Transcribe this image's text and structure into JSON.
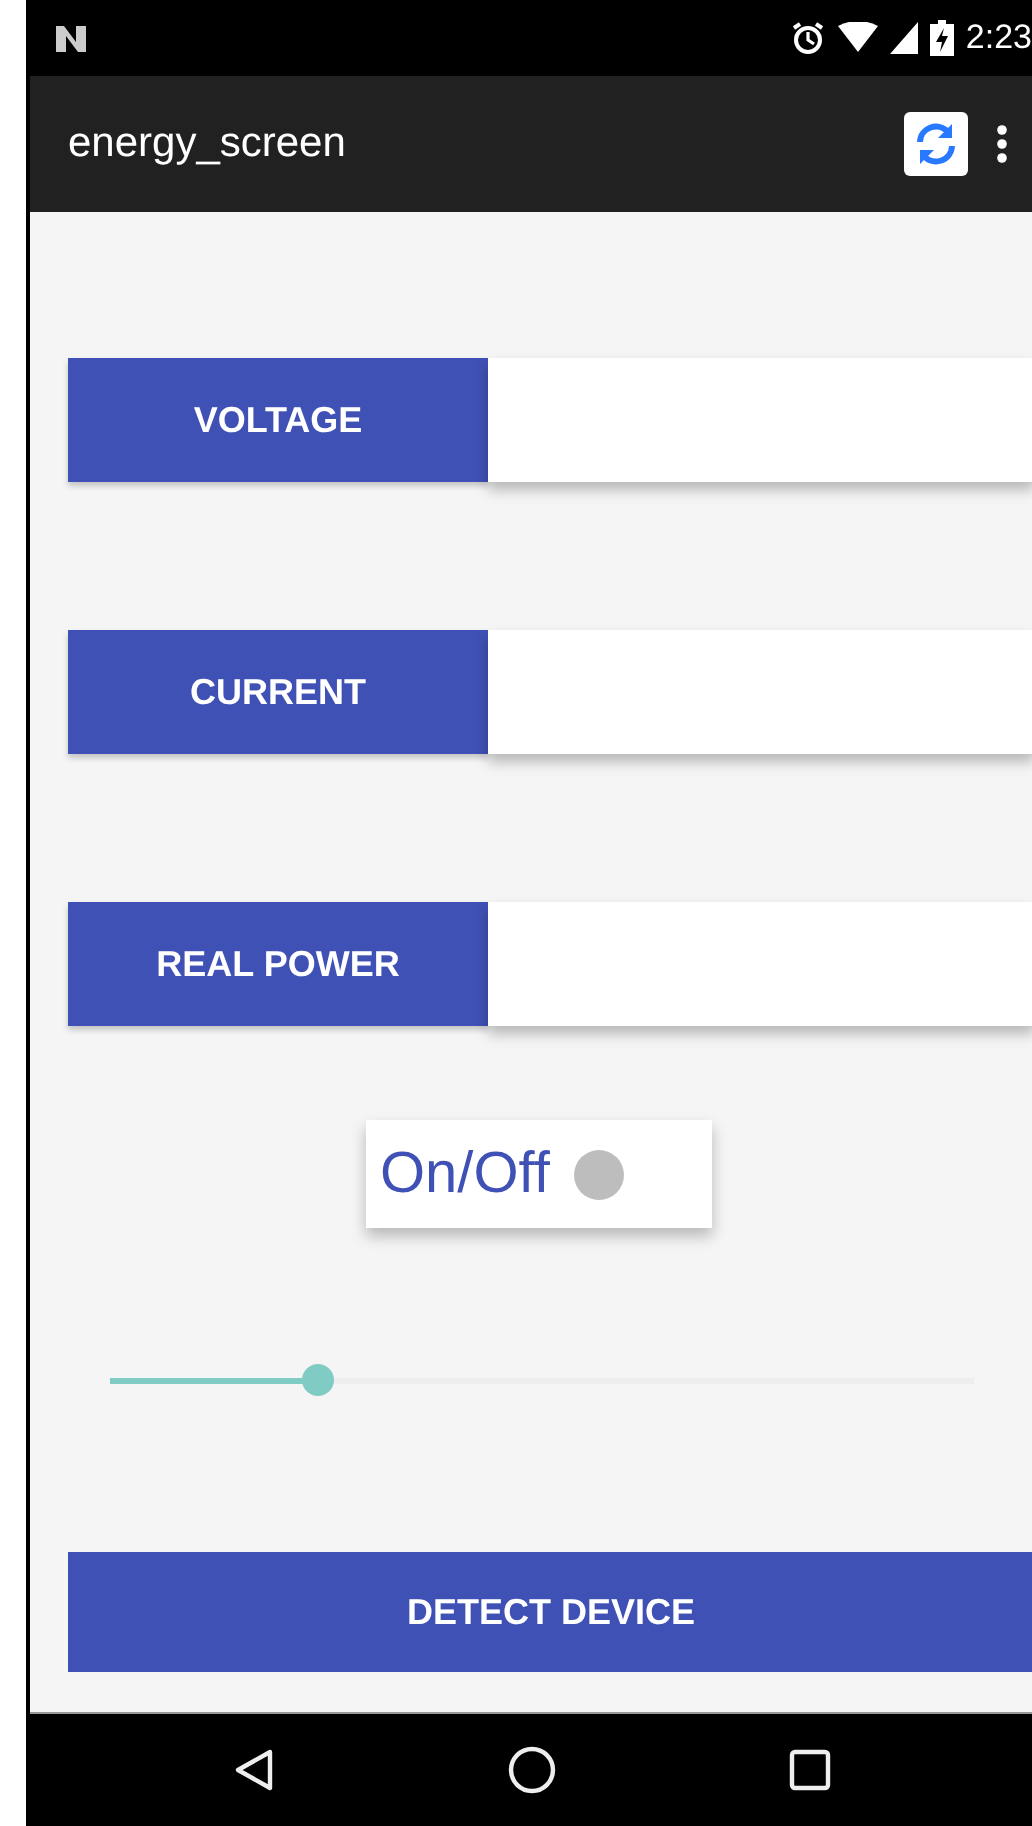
{
  "status_bar": {
    "time": "2:23"
  },
  "app_bar": {
    "title": "energy_screen"
  },
  "readings": [
    {
      "label": "VOLTAGE"
    },
    {
      "label": "CURRENT"
    },
    {
      "label": "REAL POWER"
    }
  ],
  "switch": {
    "label": "On/Off",
    "on": false
  },
  "slider": {
    "level": 0.24
  },
  "action_button": {
    "label": "DETECT DEVICE"
  }
}
